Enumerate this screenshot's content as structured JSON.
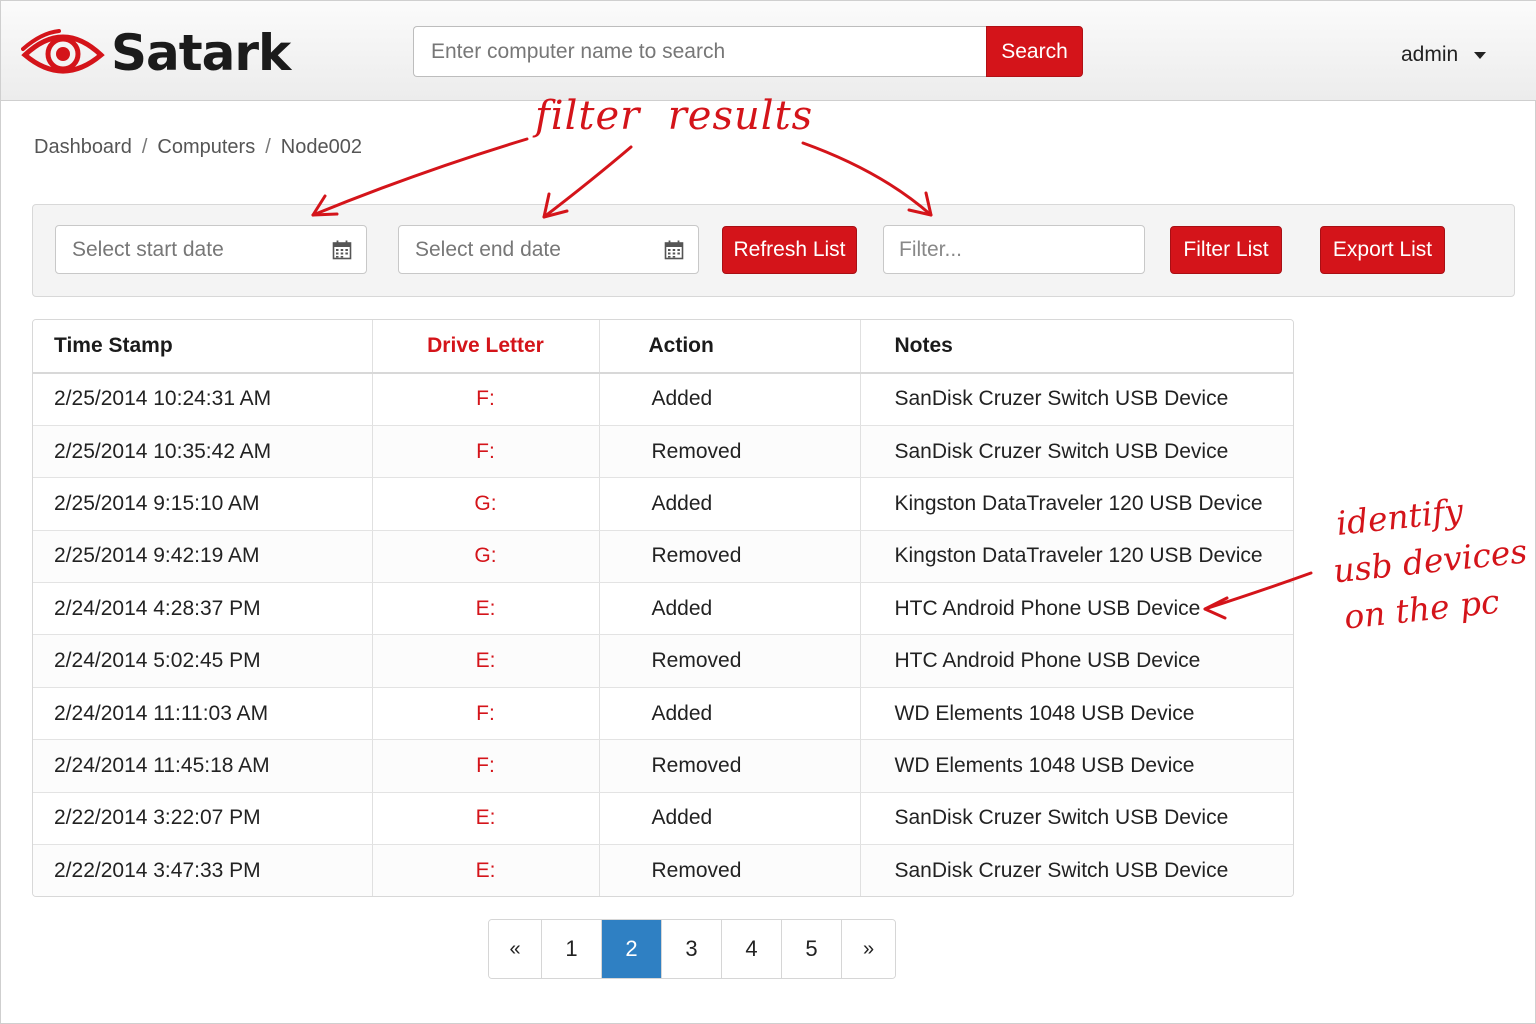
{
  "app": {
    "brand_name": "Satark",
    "brand_color": "#d4141a"
  },
  "header": {
    "search_placeholder": "Enter computer name to search",
    "search_button": "Search",
    "user_name": "admin"
  },
  "breadcrumb": {
    "items": [
      "Dashboard",
      "Computers",
      "Node002"
    ],
    "separator": "/"
  },
  "filters": {
    "start_date_placeholder": "Select start date",
    "end_date_placeholder": "Select end date",
    "refresh_button": "Refresh List",
    "filter_placeholder": "Filter...",
    "filter_button": "Filter List",
    "export_button": "Export List"
  },
  "table": {
    "columns": [
      "Time Stamp",
      "Drive Letter",
      "Action",
      "Notes"
    ],
    "rows": [
      [
        "2/25/2014 10:24:31 AM",
        "F:",
        "Added",
        "SanDisk Cruzer Switch USB Device"
      ],
      [
        "2/25/2014 10:35:42 AM",
        "F:",
        "Removed",
        "SanDisk Cruzer Switch USB Device"
      ],
      [
        "2/25/2014 9:15:10 AM",
        "G:",
        "Added",
        "Kingston DataTraveler 120 USB Device"
      ],
      [
        "2/25/2014 9:42:19 AM",
        "G:",
        "Removed",
        "Kingston DataTraveler 120 USB Device"
      ],
      [
        "2/24/2014 4:28:37 PM",
        "E:",
        "Added",
        "HTC Android Phone USB Device"
      ],
      [
        "2/24/2014 5:02:45 PM",
        "E:",
        "Removed",
        "HTC Android Phone USB Device"
      ],
      [
        "2/24/2014 11:11:03 AM",
        "F:",
        "Added",
        "WD Elements 1048 USB Device"
      ],
      [
        "2/24/2014 11:45:18 AM",
        "F:",
        "Removed",
        "WD Elements 1048 USB Device"
      ],
      [
        "2/22/2014 3:22:07 PM",
        "E:",
        "Added",
        "SanDisk Cruzer Switch USB Device"
      ],
      [
        "2/22/2014 3:47:33 PM",
        "E:",
        "Removed",
        "SanDisk Cruzer Switch USB Device"
      ]
    ]
  },
  "pagination": {
    "prev": "«",
    "pages": [
      "1",
      "2",
      "3",
      "4",
      "5"
    ],
    "active_page": "2",
    "next": "»"
  },
  "annotations": {
    "filter_results": "filter  results",
    "identify_line1": "identify",
    "identify_line2": "usb devices",
    "identify_line3": "on the pc"
  },
  "icons": {
    "logo": "eye-icon",
    "user_menu": "chevron-down-icon",
    "date_picker": "calendar-icon"
  }
}
